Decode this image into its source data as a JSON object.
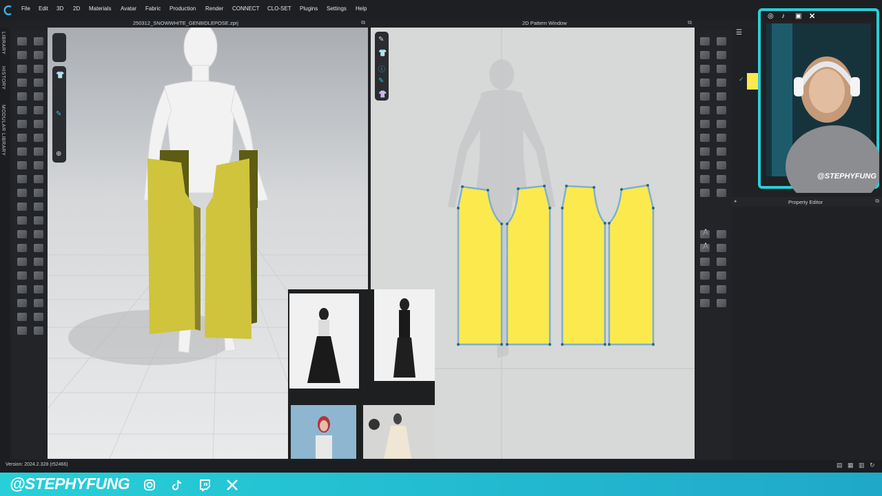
{
  "menu": [
    "File",
    "Edit",
    "3D",
    "2D",
    "Materials",
    "Avatar",
    "Fabric",
    "Production",
    "Render",
    "CONNECT",
    "CLO-SET",
    "Plugins",
    "Settings",
    "Help"
  ],
  "left_rail": {
    "tabs": [
      "LIBRARY",
      "HISTORY",
      "MODULAR LIBRARY"
    ]
  },
  "view3d": {
    "title": "250312_SNOWWHITE_GEN8IDLEPOSE.zprj"
  },
  "view2d": {
    "title": "2D Pattern Window"
  },
  "property_editor": {
    "title": "Property Editor"
  },
  "status": {
    "version": "Version: 2024.2.328 (r52466)"
  },
  "webcam": {
    "handle": "@STEPHYFUNG"
  },
  "brand": {
    "name": "@STEPHYFUNG",
    "icons": [
      "instagram-icon",
      "tiktok-icon",
      "twitch-icon",
      "x-icon"
    ]
  },
  "colors": {
    "pattern_fill": "#fbe94e",
    "garment_3d": "#cfc43c",
    "accent": "#27d0d9",
    "menu_bg": "#1d1f22"
  }
}
